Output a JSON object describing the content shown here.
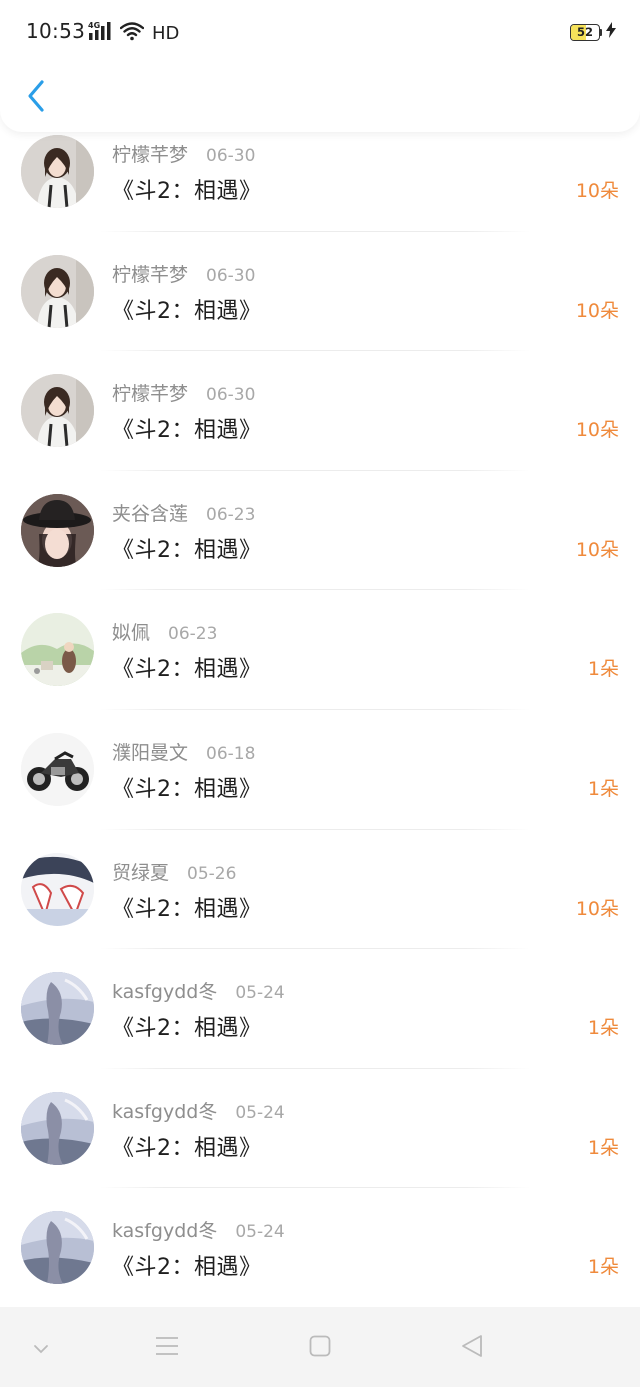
{
  "status_bar": {
    "time": "10:53",
    "network": "4G",
    "hd": "HD",
    "battery_level": "52",
    "battery_fraction": 0.52,
    "icons": [
      "signal-icon",
      "wifi-icon",
      "charging-icon"
    ]
  },
  "header": {
    "back_icon": "chevron-left-icon",
    "accent_color": "#2a9ee8"
  },
  "colors": {
    "gift_count": "#ef8a3c",
    "username": "#8e8e8e",
    "date": "#a8a8a8"
  },
  "list": {
    "items": [
      {
        "user": "柠檬芊梦",
        "date": "06-30",
        "title": "《斗2：相遇》",
        "count": "10朵",
        "avatar": "portrait-girl"
      },
      {
        "user": "柠檬芊梦",
        "date": "06-30",
        "title": "《斗2：相遇》",
        "count": "10朵",
        "avatar": "portrait-girl"
      },
      {
        "user": "柠檬芊梦",
        "date": "06-30",
        "title": "《斗2：相遇》",
        "count": "10朵",
        "avatar": "portrait-girl"
      },
      {
        "user": "夹谷含莲",
        "date": "06-23",
        "title": "《斗2：相遇》",
        "count": "10朵",
        "avatar": "girl-hat"
      },
      {
        "user": "姒佩",
        "date": "06-23",
        "title": "《斗2：相遇》",
        "count": "1朵",
        "avatar": "cartoon-landscape"
      },
      {
        "user": "濮阳曼文",
        "date": "06-18",
        "title": "《斗2：相遇》",
        "count": "1朵",
        "avatar": "motorcycle"
      },
      {
        "user": "贸绿夏",
        "date": "05-26",
        "title": "《斗2：相遇》",
        "count": "10朵",
        "avatar": "anime"
      },
      {
        "user": "kasfgydd冬",
        "date": "05-24",
        "title": "《斗2：相遇》",
        "count": "1朵",
        "avatar": "anime-sky"
      },
      {
        "user": "kasfgydd冬",
        "date": "05-24",
        "title": "《斗2：相遇》",
        "count": "1朵",
        "avatar": "anime-sky"
      },
      {
        "user": "kasfgydd冬",
        "date": "05-24",
        "title": "《斗2：相遇》",
        "count": "1朵",
        "avatar": "anime-sky"
      }
    ]
  },
  "system_nav": {
    "icons": [
      "chevron-down-icon",
      "menu-icon",
      "home-square-icon",
      "back-triangle-icon"
    ]
  }
}
